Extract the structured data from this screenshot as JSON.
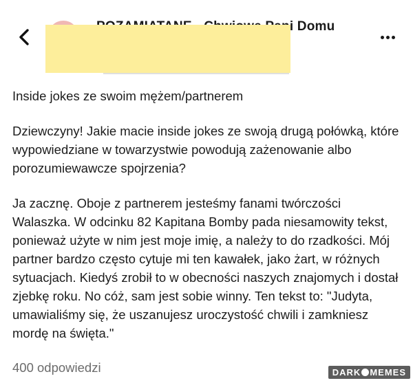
{
  "header": {
    "back_icon": "chevron-left-icon",
    "group_name": "POZAMIATANE - Chwiowe Pani Domu",
    "more_icon": "more-horizontal-icon",
    "redaction_color": "#fdee9b"
  },
  "post": {
    "title": "Inside jokes ze swoim mężem/partnerem",
    "paragraphs": [
      "Dziewczyny! Jakie macie inside jokes ze swoją drugą połówką, które wypowiedziane w towarzystwie powodują zażenowanie albo porozumiewawcze spojrzenia?",
      "Ja zacznę. Oboje z partnerem jesteśmy fanami twórczości Walaszka. W odcinku 82 Kapitana Bomby pada niesamowity tekst, ponieważ użyte w nim jest moje imię, a należy to do rzadkości. Mój partner bardzo często cytuje mi ten kawałek, jako żart, w różnych sytuacjach. Kiedyś zrobił to w obecności naszych znajomych i dostał zjebkę roku. No cóż, sam jest sobie winny. Ten tekst to: \"Judyta, umawialiśmy się, że uszanujesz uroczystość chwili i zamkniesz mordę na święta.\""
    ]
  },
  "footer": {
    "replies_label": "400 odpowiedzi"
  },
  "watermark": {
    "left": "DARK",
    "right": "MEMES"
  }
}
